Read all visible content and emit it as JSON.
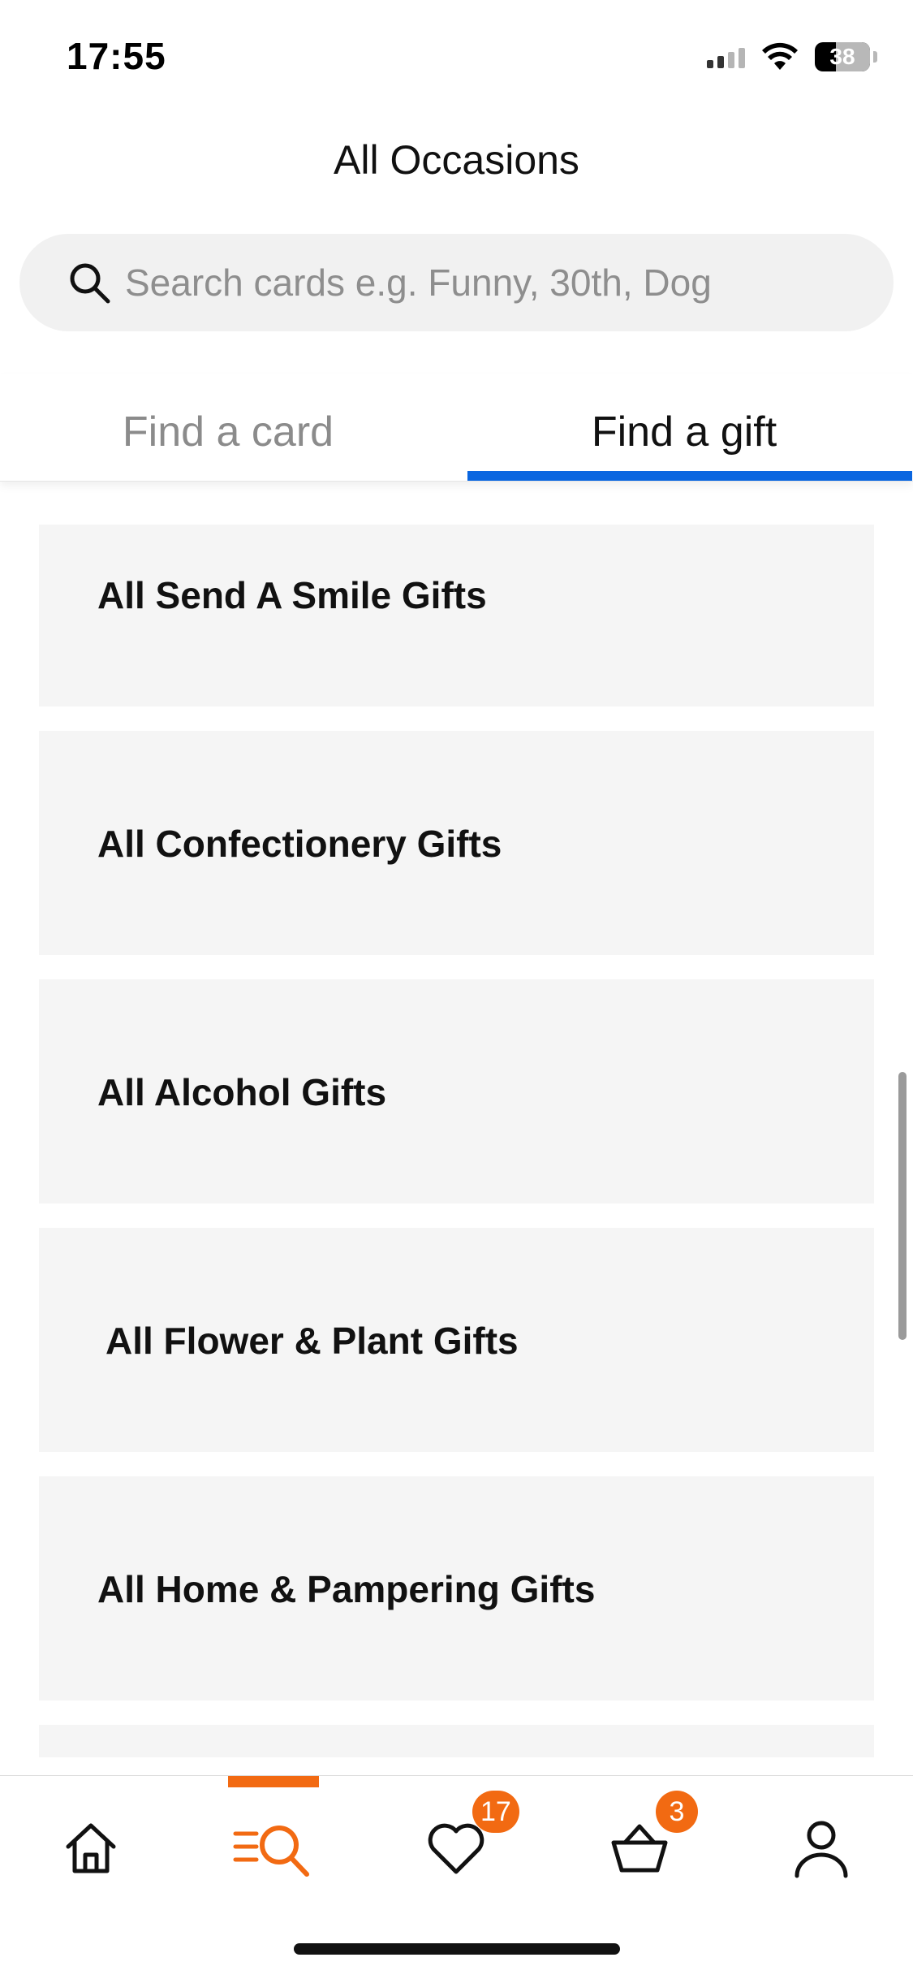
{
  "status_bar": {
    "time": "17:55",
    "battery": "38",
    "battery_level": 0.38,
    "icons": [
      "signal-icon",
      "wifi-icon",
      "battery-icon"
    ]
  },
  "header": {
    "title": "All Occasions"
  },
  "search": {
    "placeholder": "Search cards e.g. Funny, 30th, Dog",
    "value": ""
  },
  "tabs": [
    {
      "label": "Find a card",
      "active": false
    },
    {
      "label": "Find a gift",
      "active": true
    }
  ],
  "gift_categories": [
    {
      "label": "All Send A Smile Gifts"
    },
    {
      "label": "All Confectionery Gifts"
    },
    {
      "label": "All Alcohol Gifts"
    },
    {
      "label": "All Flower & Plant Gifts"
    },
    {
      "label": "All Home & Pampering Gifts"
    }
  ],
  "bottom_nav": {
    "items": [
      {
        "name": "home",
        "icon": "home-icon"
      },
      {
        "name": "browse",
        "icon": "browse-search-icon",
        "active": true
      },
      {
        "name": "favourites",
        "icon": "heart-icon",
        "badge": "17"
      },
      {
        "name": "basket",
        "icon": "basket-icon",
        "badge": "3"
      },
      {
        "name": "account",
        "icon": "user-icon"
      }
    ]
  },
  "colors": {
    "accent": "#f26a12",
    "tab_underline": "#0a66e0",
    "card_background": "#f5f5f5",
    "search_background": "#f1f1f1"
  }
}
